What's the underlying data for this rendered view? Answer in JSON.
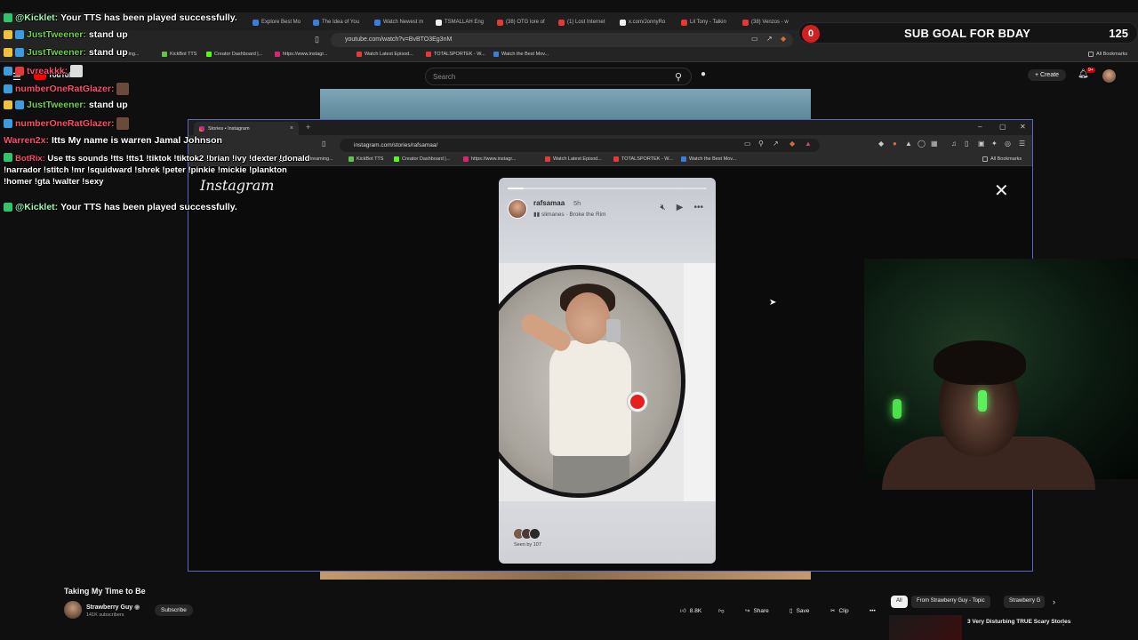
{
  "back_browser": {
    "tabs": [
      "Explore Best Mo",
      "The Idea of You",
      "Watch Newest m",
      "TSMALLAH Eng",
      "(38) OTG lore of",
      "(1) Lost Internet",
      "x.com/JonnyRo",
      "Lil Tony - Talkin",
      "(38) Venzos - w"
    ],
    "url": "youtube.com/watch?v=BvBTO3Eg3nM",
    "bookmarks": [
      "ming...",
      "KickBot TTS",
      "Creator Dashboard |...",
      "https://www.instagr...",
      "Watch Latest Episod...",
      "TOTALSPORTEK - W...",
      "Watch the Best Mov..."
    ],
    "all_bookmarks": "All Bookmarks"
  },
  "youtube": {
    "logo_text": "YouTube",
    "search_placeholder": "Search",
    "create_label": "Create",
    "notif_badge": "9+",
    "video_title": "Taking My Time to Be",
    "channel_name": "Strawberry Guy",
    "channel_subs": "141K subscribers",
    "subscribe_label": "Subscribe",
    "likes": "8.8K",
    "share_label": "Share",
    "save_label": "Save",
    "clip_label": "Clip",
    "chips": [
      "All",
      "From Strawberry Guy - Topic",
      "Strawberry G"
    ],
    "rec_title": "3 Very Disturbing TRUE Scary Stories"
  },
  "instagram_window": {
    "tab_title": "Stories • Instagram",
    "url": "instagram.com/stories/rafsamaa/",
    "bookmarks": [
      "The best streaming...",
      "KickBot TTS",
      "Creator Dashboard |...",
      "https://www.instagr...",
      "Watch Latest Episod...",
      "TOTALSPORTEK - W...",
      "Watch the Best Mov..."
    ],
    "all_bookmarks": "All Bookmarks",
    "logo": "Instagram",
    "story": {
      "username": "rafsamaa",
      "time": "5h",
      "music": "slimanes · Broke the Rim",
      "seen_by": "Seen by 107",
      "progress": 0.08
    }
  },
  "overlay": {
    "sub_goal_current": "0",
    "sub_goal_label": "SUB GOAL FOR BDAY",
    "sub_goal_target": "125"
  },
  "chat": [
    {
      "user": "@Kicklet:",
      "text": "Your TTS has been played successfully.",
      "color": "#ffffff"
    },
    {
      "user": "JustTweener:",
      "text": "stand up",
      "color": "#6fd24b"
    },
    {
      "user": "JustTweener:",
      "text": "stand up",
      "color": "#6fd24b"
    },
    {
      "user": "tvreakkk:",
      "text": "",
      "color": "#ff4d6d"
    },
    {
      "user": "numberOneRatGlazer:",
      "text": "",
      "color": "#ff4d6d"
    },
    {
      "user": "JustTweener:",
      "text": "stand up",
      "color": "#6fd24b"
    },
    {
      "user": "numberOneRatGlazer:",
      "text": "",
      "color": "#ff4d6d"
    },
    {
      "user": "Warren2x:",
      "text": "Itts My name is warren Jamal Johnson",
      "color": "#ff4d6d"
    },
    {
      "user": "BotRix:",
      "text": "Use tts sounds !tts !tts1 !tiktok !tiktok2 !brian !ivy !dexter !donald !narrador !stitch !mr !squidward !shrek !peter !pinkie !mickie !plankton !homer !gta !walter !sexy",
      "color": "#ff4d6d"
    },
    {
      "user": "@Kicklet:",
      "text": "Your TTS has been played successfully.",
      "color": "#ffffff"
    }
  ]
}
